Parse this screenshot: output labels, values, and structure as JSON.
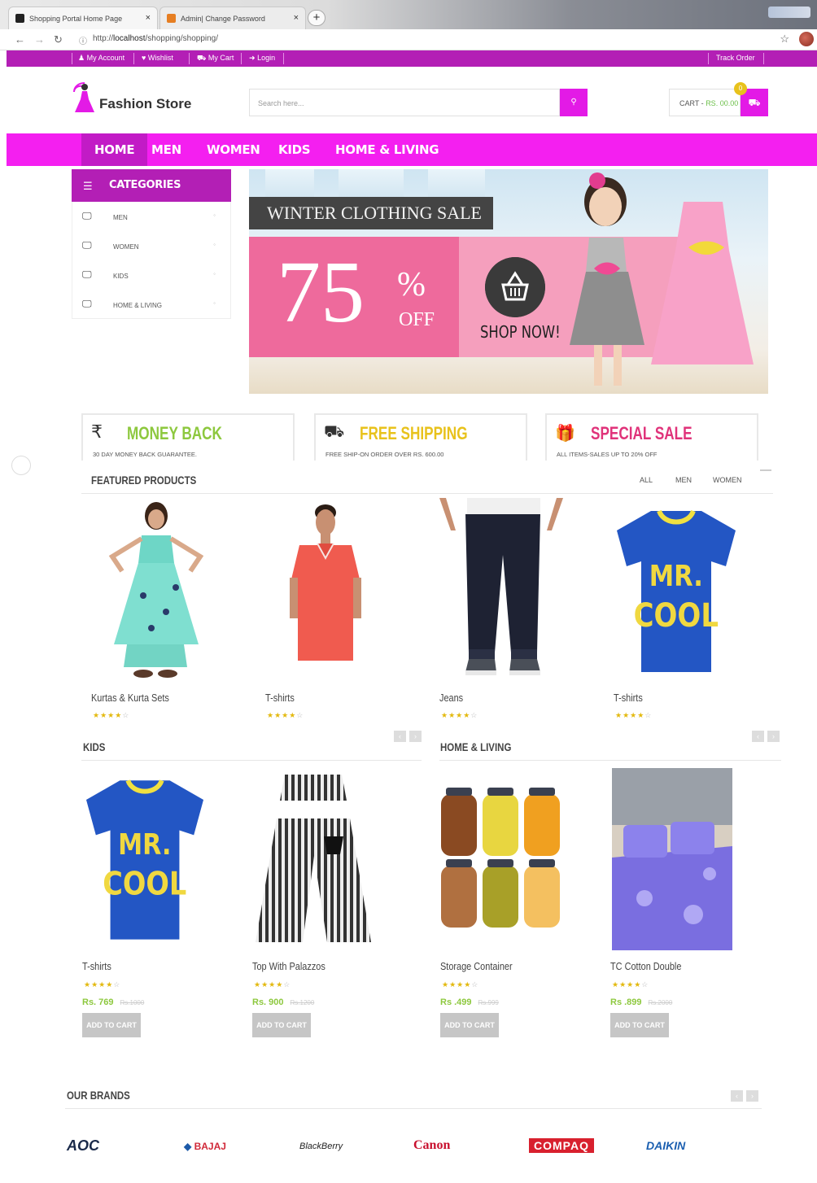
{
  "browser": {
    "tabs": [
      {
        "title": "Shopping Portal Home Page"
      },
      {
        "title": "Admin| Change Password"
      }
    ],
    "url_prefix": "http://",
    "url_host": "localhost",
    "url_path": "/shopping/shopping/"
  },
  "topbar": {
    "links": [
      {
        "icon": "user-icon",
        "label": "My Account"
      },
      {
        "icon": "heart-icon",
        "label": "Wishlist"
      },
      {
        "icon": "cart-icon",
        "label": "My Cart"
      },
      {
        "icon": "login-icon",
        "label": "Login"
      }
    ],
    "track_order": "Track Order"
  },
  "header": {
    "logo_text": "Fashion Store",
    "search_placeholder": "Search here...",
    "cart_label": "CART - ",
    "cart_amount": "RS. 00.00",
    "cart_count": "0"
  },
  "nav": {
    "items": [
      "HOME",
      "MEN",
      "WOMEN",
      "KIDS",
      "HOME & LIVING"
    ]
  },
  "categories": {
    "title": "CATEGORIES",
    "items": [
      "MEN",
      "WOMEN",
      "KIDS",
      "HOME & LIVING"
    ]
  },
  "banner": {
    "title": "WINTER CLOTHING SALE",
    "percent": "75",
    "percent_sign": "%",
    "off": "OFF",
    "cta": "SHOP NOW!"
  },
  "features": [
    {
      "icon": "rupee-icon",
      "title": "MONEY BACK",
      "subtitle": "30 DAY MONEY BACK GUARANTEE.",
      "color": "#8dc83e"
    },
    {
      "icon": "truck-icon",
      "title": "FREE SHIPPING",
      "subtitle": "FREE SHIP-ON ORDER OVER RS. 600.00",
      "color": "#e8c21c"
    },
    {
      "icon": "gift-icon",
      "title": "SPECIAL SALE",
      "subtitle": "ALL ITEMS-SALES UP TO 20% OFF",
      "color": "#e0337a"
    }
  ],
  "featured": {
    "title": "FEATURED PRODUCTS",
    "tabs": [
      "ALL",
      "MEN",
      "WOMEN"
    ],
    "products": [
      {
        "name": "Kurtas & Kurta Sets",
        "rating": 4
      },
      {
        "name": "T-shirts",
        "rating": 4
      },
      {
        "name": "Jeans",
        "rating": 4
      },
      {
        "name": "T-shirts",
        "rating": 4
      }
    ]
  },
  "kids": {
    "title": "KIDS",
    "products": [
      {
        "name": "T-shirts",
        "price": "Rs. 769",
        "old_price": "Rs.1000",
        "cta": "ADD TO CART",
        "rating": 4
      },
      {
        "name": "Top With Palazzos",
        "price": "Rs. 900",
        "old_price": "Rs.1200",
        "cta": "ADD TO CART",
        "rating": 4
      }
    ]
  },
  "home_living": {
    "title": "HOME & LIVING",
    "products": [
      {
        "name": "Storage Container",
        "price": "Rs .499",
        "old_price": "Rs.999",
        "cta": "ADD TO CART",
        "rating": 4
      },
      {
        "name": "TC Cotton Double",
        "price": "Rs .899",
        "old_price": "Rs.2000",
        "cta": "ADD TO CART",
        "rating": 4
      }
    ]
  },
  "brands": {
    "title": "OUR BRANDS",
    "items": [
      "AOC",
      "BAJAJ",
      "BlackBerry",
      "Canon",
      "COMPAQ",
      "DAIKIN"
    ]
  },
  "colors": {
    "magenta": "#f41ff0",
    "purple": "#b31fb5",
    "green_price": "#8dc83e"
  }
}
